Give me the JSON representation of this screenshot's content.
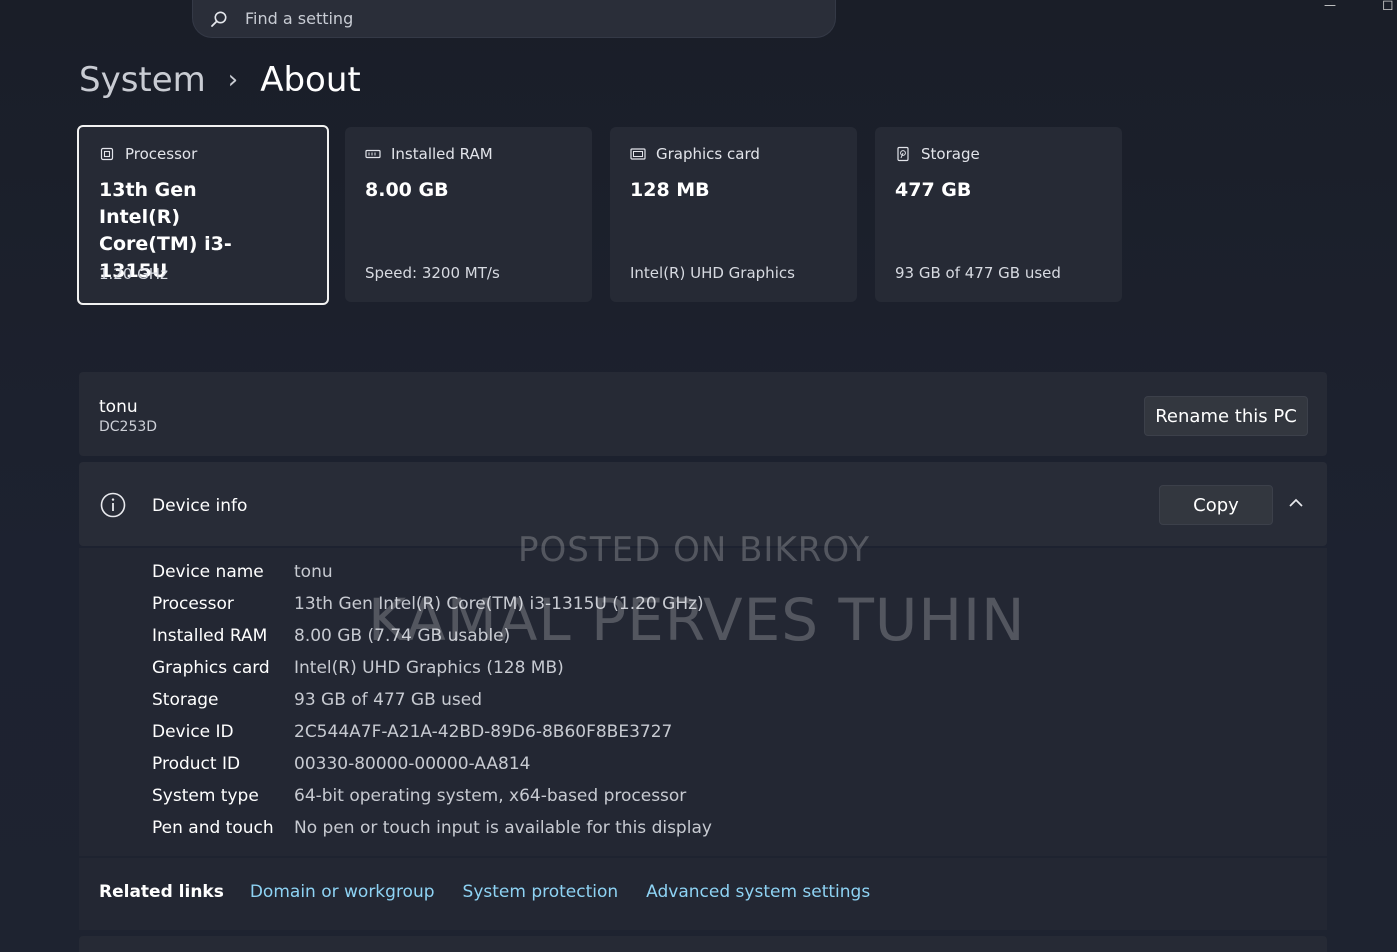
{
  "search": {
    "placeholder": "Find a setting"
  },
  "window": {
    "minimize": "—",
    "maximize": "◻"
  },
  "breadcrumb": {
    "parent": "System",
    "separator": "›",
    "current": "About"
  },
  "cards": [
    {
      "title": "Processor",
      "value": "13th Gen Intel(R) Core(TM) i3-1315U",
      "sub": "1.20 GHz",
      "icon": "processor-icon"
    },
    {
      "title": "Installed RAM",
      "value": "8.00 GB",
      "sub": "Speed: 3200 MT/s",
      "icon": "ram-icon"
    },
    {
      "title": "Graphics card",
      "value": "128 MB",
      "sub": "Intel(R) UHD Graphics",
      "icon": "graphics-card-icon"
    },
    {
      "title": "Storage",
      "value": "477 GB",
      "sub": "93 GB of 477 GB used",
      "icon": "storage-icon"
    }
  ],
  "pc": {
    "name": "tonu",
    "model": "DC253D",
    "rename_label": "Rename this PC"
  },
  "device_info": {
    "title": "Device info",
    "copy_label": "Copy",
    "specs": [
      {
        "label": "Device name",
        "value": "tonu"
      },
      {
        "label": "Processor",
        "value": "13th Gen Intel(R) Core(TM) i3-1315U (1.20 GHz)"
      },
      {
        "label": "Installed RAM",
        "value": "8.00 GB (7.74 GB usable)"
      },
      {
        "label": "Graphics card",
        "value": "Intel(R) UHD Graphics (128 MB)"
      },
      {
        "label": "Storage",
        "value": "93 GB of 477 GB used"
      },
      {
        "label": "Device ID",
        "value": "2C544A7F-A21A-42BD-89D6-8B60F8BE3727"
      },
      {
        "label": "Product ID",
        "value": "00330-80000-00000-AA814"
      },
      {
        "label": "System type",
        "value": "64-bit operating system, x64-based processor"
      },
      {
        "label": "Pen and touch",
        "value": "No pen or touch input is available for this display"
      }
    ]
  },
  "related_links": {
    "title": "Related links",
    "links": [
      "Domain or workgroup",
      "System protection",
      "Advanced system settings"
    ]
  },
  "watermark": {
    "line1": "POSTED ON BIKROY",
    "line2": "KAMAL PERVES TUHIN"
  },
  "colors": {
    "link": "#8ed3f4",
    "card_bg": "#262a35",
    "page_bg": "#1b1f2a"
  }
}
